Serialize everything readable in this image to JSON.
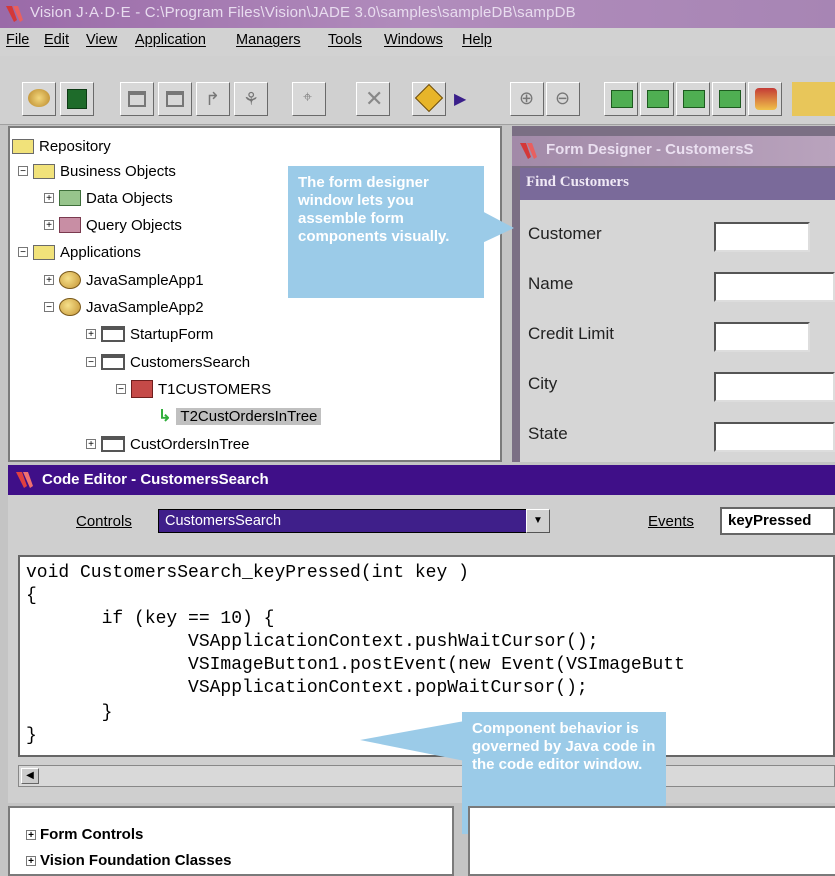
{
  "app": {
    "title": "Vision J·A·D·E - C:\\Program Files\\Vision\\JADE 3.0\\samples\\sampleDB\\sampDB",
    "menu": [
      "File",
      "Edit",
      "View",
      "Application",
      "Managers",
      "Tools",
      "Windows",
      "Help"
    ]
  },
  "toolbar": {
    "buttons": [
      "run-icon",
      "save-icon",
      "blank-form-icon",
      "new-form-icon",
      "import-icon",
      "wizard-icon",
      "wand-icon",
      "delete-icon",
      "navigate-icon",
      "play-icon",
      "zoom-in-icon",
      "zoom-out-icon",
      "db-icon-1",
      "db-icon-2",
      "db-icon-3",
      "db-icon-4",
      "users-icon"
    ]
  },
  "repository": {
    "root": "Repository",
    "business_objects": "Business Objects",
    "data_objects": "Data Objects",
    "query_objects": "Query Objects",
    "applications": "Applications",
    "app1": "JavaSampleApp1",
    "app2": "JavaSampleApp2",
    "startup_form": "StartupForm",
    "customers_search": "CustomersSearch",
    "t1customers": "T1CUSTOMERS",
    "t2cust": "T2CustOrdersInTree",
    "cust_orders": "CustOrdersInTree"
  },
  "callout_top": "The form designer window lets you assemble form components visually.",
  "callout_bottom": "Component behavior is governed by Java code in the code editor window.",
  "form_designer": {
    "title": "Form Designer - CustomersS",
    "form_title": "Find Customers",
    "labels": {
      "customer": "Customer",
      "name": "Name",
      "credit_limit": "Credit Limit",
      "city": "City",
      "state": "State"
    }
  },
  "code_editor": {
    "title": "Code Editor - CustomersSearch",
    "controls_label": "Controls",
    "controls_value": "CustomersSearch",
    "events_label": "Events",
    "events_value": "keyPressed",
    "code": [
      "void CustomersSearch_keyPressed(int key )",
      "{",
      "       if (key == 10) {",
      "               VSApplicationContext.pushWaitCursor();",
      "               VSImageButton1.postEvent(new Event(VSImageButt",
      "               VSApplicationContext.popWaitCursor();",
      "       }",
      "}"
    ]
  },
  "bottom": {
    "form_controls": "Form Controls",
    "vision_foundation": "Vision Foundation Classes"
  },
  "colors": {
    "accent_purple": "#3f0f88",
    "callout_blue": "#9bcbe8",
    "title_mauve": "#a785b4"
  }
}
